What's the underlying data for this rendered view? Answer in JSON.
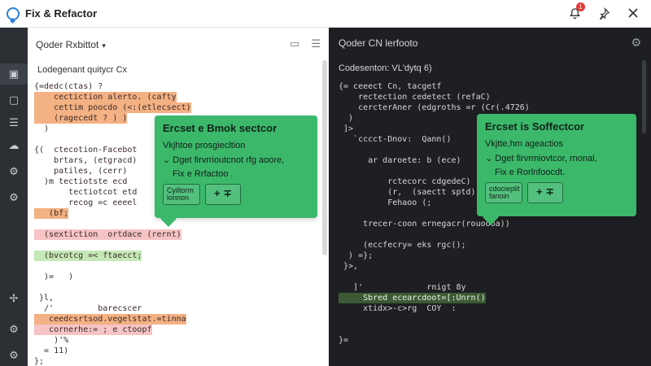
{
  "app": {
    "title": "Fix & Refactor",
    "notification_count": "1"
  },
  "titlebar_icons": [
    "bell-icon",
    "pin-icon",
    "close-icon"
  ],
  "activity_bar": [
    {
      "name": "files-icon",
      "glyph": "▣"
    },
    {
      "name": "bookmark-icon",
      "glyph": "▢"
    },
    {
      "name": "list-icon",
      "glyph": "☰"
    },
    {
      "name": "cloud-icon",
      "glyph": "☁"
    },
    {
      "name": "gear-icon",
      "glyph": "⚙"
    },
    {
      "name": "gear-icon-2",
      "glyph": "⚙"
    },
    {
      "name": "pin-icon",
      "glyph": "✢"
    },
    {
      "name": "settings-icon",
      "glyph": "⚙"
    },
    {
      "name": "settings-icon-2",
      "glyph": "⚙"
    }
  ],
  "left": {
    "header": "Qoder Rxbittot",
    "subheader": "Lodegenant quitycr Cx",
    "code": [
      "{=dedc(ctas) ?",
      "    cectiction alerto. (cafty",
      "    cettim poocdo (<:(etlecsect)",
      "    (ragecedt ? ) )",
      "  )",
      "",
      "{(  ctecotion-Facebot",
      "    brtars, (etgracd)",
      "    patiles, (cerr)",
      "  )m tectiotste ecd",
      "       tectiotcot etd",
      "       recog =c eeeel",
      "   (bf;",
      "",
      "  (sextiction  ortdace (rernt)",
      "",
      "  (bvcotcg =< ftaecct;",
      "",
      "  )=   )",
      "",
      " }l,",
      "  /'         barecscer",
      "   ceedcsrtsod.vegelstat.=tinna",
      "   cornerhe:= ; e ctoopf",
      "    )'%",
      "  = 11)",
      "};"
    ],
    "popup": {
      "title": "Ercset e Bmok sectcor",
      "line1": "Vkjhtoe prosgiecltion",
      "line2": "Dget firvrrioutcnot rfg aoore,",
      "line3": "Fix e Rrfactoo .",
      "btn_small": "Cyiltorm lonnon",
      "btn_big": "+ ∓"
    }
  },
  "right": {
    "header": "Qoder CN lerfooto",
    "subheader": "Codesenton: VL'dytq 6)",
    "code": [
      "{= ceeect Cn, tacgetf",
      "    rectection cedetect (refaC)",
      "    cercterAner (edgroths =r (Cr(.4726)",
      "  )",
      " ]>",
      "   `cccct-Dnov:  Qann()",
      "",
      "      ar daroete: b (ece)",
      "",
      "          rctecorc cdgedeC)",
      "          (r,  (saectt sptd)",
      "          Fehaoo (;",
      "",
      "     trecer-coon ernegacr(rouoooa))",
      "",
      "     (eccfecry= eks rgc();",
      "  ) =};",
      " }>,",
      "",
      "   ]'             rnigt 8y",
      "     Sbred ecearcdoot=[:Unrn()",
      "     xtidx>-c>rg  COY  :",
      "",
      "",
      "}="
    ],
    "popup": {
      "title": "Ercset is Soffectcor",
      "line1": "Vkjtte,hm ageactios",
      "line2": "Dget firvrmiovtcor, rnonal,",
      "line3": "Fix e Rorlnfoocdt.",
      "btn_small": "cdocieplit fanoin",
      "btn_big": "+ ∓"
    }
  }
}
